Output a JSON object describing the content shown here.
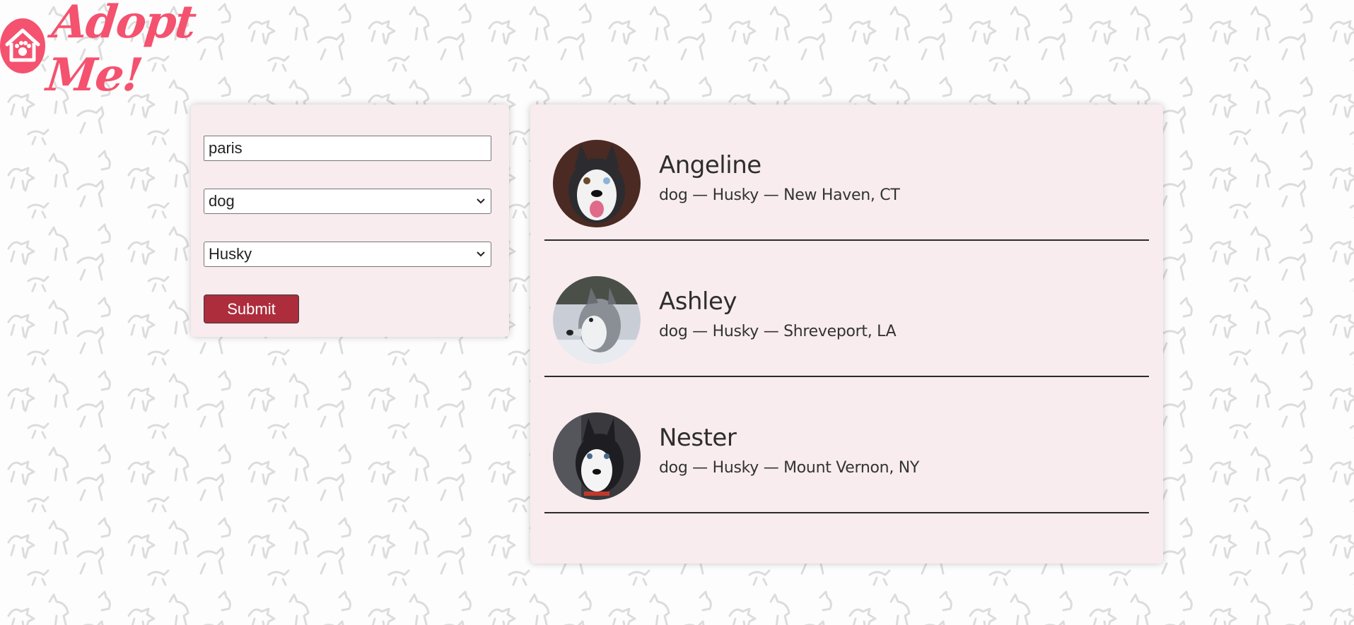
{
  "app": {
    "logo_text": "Adopt Me!"
  },
  "search": {
    "location_value": "paris",
    "animal_value": "dog",
    "breed_value": "Husky",
    "submit_label": "Submit"
  },
  "results": [
    {
      "name": "Angeline",
      "animal": "dog",
      "breed": "Husky",
      "location": "New Haven, CT",
      "info": "dog — Husky — New Haven, CT"
    },
    {
      "name": "Ashley",
      "animal": "dog",
      "breed": "Husky",
      "location": "Shreveport, LA",
      "info": "dog — Husky — Shreveport, LA"
    },
    {
      "name": "Nester",
      "animal": "dog",
      "breed": "Husky",
      "location": "Mount Vernon, NY",
      "info": "dog — Husky — Mount Vernon, NY"
    }
  ],
  "colors": {
    "brand": "#f4526f",
    "submit_bg": "#ad2d3d",
    "card_bg": "#f8ecee"
  }
}
